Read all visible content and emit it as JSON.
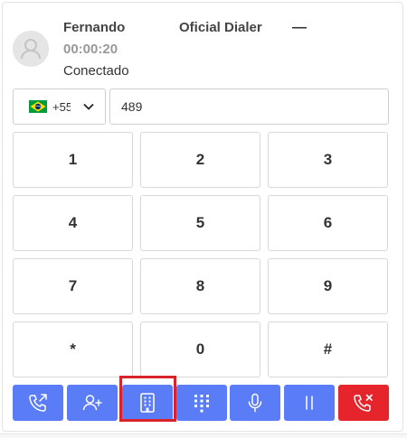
{
  "header": {
    "caller_name": "Fernando",
    "call_timer": "00:00:20",
    "call_status": "Conectado",
    "app_title": "Oficial Dialer",
    "minimize_label": "—"
  },
  "dial": {
    "country_code": "+55",
    "country_flag": "brazil-flag-icon",
    "number_value": "489"
  },
  "keypad": {
    "keys": [
      "1",
      "2",
      "3",
      "4",
      "5",
      "6",
      "7",
      "8",
      "9",
      "*",
      "0",
      "#"
    ]
  },
  "actions": [
    {
      "name": "transfer-call-button",
      "icon": "phone-forward-icon"
    },
    {
      "name": "add-participant-button",
      "icon": "user-plus-icon"
    },
    {
      "name": "company-button",
      "icon": "building-icon",
      "highlighted": true
    },
    {
      "name": "show-keypad-button",
      "icon": "keypad-icon"
    },
    {
      "name": "microphone-button",
      "icon": "microphone-icon"
    },
    {
      "name": "hold-button",
      "icon": "pause-icon"
    },
    {
      "name": "hang-up-button",
      "icon": "phone-hangup-icon"
    }
  ],
  "colors": {
    "action_blue": "#5b7cf7",
    "hangup_red": "#e5252b",
    "highlight_red": "#d8232a"
  }
}
